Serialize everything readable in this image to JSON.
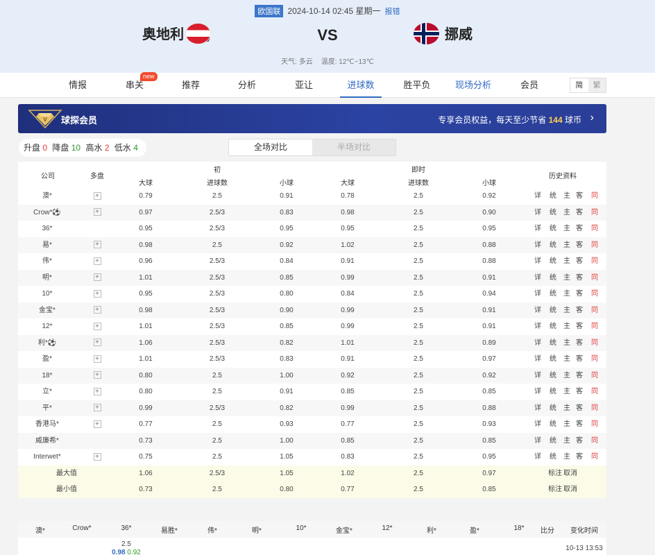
{
  "header": {
    "league": "欧国联",
    "datetime": "2024-10-14 02:45 星期一",
    "report": "报错",
    "home": "奥地利 (主)",
    "away": "挪威",
    "vs": "VS",
    "weather_label": "天气: 多云",
    "temp_label": "温度: 12℃~13℃"
  },
  "nav": {
    "items": [
      "情报",
      "串关",
      "推荐",
      "分析",
      "亚让",
      "进球数",
      "胜平负",
      "现场分析",
      "会员"
    ],
    "active": "进球数",
    "new_badge": "new",
    "lang_simp": "简",
    "lang_trad": "繁"
  },
  "vip": {
    "title": "球探会员",
    "text_prefix": "专享会员权益，每天至少节省",
    "amount": "144",
    "text_suffix": "球币",
    "arrow": "›"
  },
  "summary": {
    "up_label": "升盘",
    "up": "0",
    "down_label": "降盘",
    "down": "10",
    "high_label": "高水",
    "high": "2",
    "low_label": "低水",
    "low": "4"
  },
  "toggle": {
    "full": "全场对比",
    "half": "半场对比"
  },
  "table": {
    "headers": {
      "company": "公司",
      "multi": "多盘",
      "initial": "初",
      "live": "即时",
      "history": "历史资料",
      "over": "大球",
      "goals": "进球数",
      "under": "小球"
    },
    "links": [
      "详",
      "统",
      "主",
      "客",
      "同"
    ],
    "rows": [
      {
        "c": "澳*",
        "m": "+",
        "o1": "0.79",
        "g1": "2.5",
        "u1": "0.91",
        "o2": "0.78",
        "g2": "2.5",
        "u2": "0.92"
      },
      {
        "c": "Crow*⚽",
        "m": "+",
        "o1": "0.97",
        "g1": "2.5/3",
        "u1": "0.83",
        "o2": "0.98",
        "g2": "2.5",
        "u2": "0.90"
      },
      {
        "c": "36*",
        "m": "",
        "o1": "0.95",
        "g1": "2.5/3",
        "u1": "0.95",
        "o2": "0.95",
        "g2": "2.5",
        "u2": "0.95"
      },
      {
        "c": "易*",
        "m": "+",
        "o1": "0.98",
        "g1": "2.5",
        "u1": "0.92",
        "o2": "1.02",
        "g2": "2.5",
        "u2": "0.88"
      },
      {
        "c": "伟*",
        "m": "+",
        "o1": "0.96",
        "g1": "2.5/3",
        "u1": "0.84",
        "o2": "0.91",
        "g2": "2.5",
        "u2": "0.88"
      },
      {
        "c": "明*",
        "m": "+",
        "o1": "1.01",
        "g1": "2.5/3",
        "u1": "0.85",
        "o2": "0.99",
        "g2": "2.5",
        "u2": "0.91"
      },
      {
        "c": "10*",
        "m": "+",
        "o1": "0.95",
        "g1": "2.5/3",
        "u1": "0.80",
        "o2": "0.84",
        "g2": "2.5",
        "u2": "0.94"
      },
      {
        "c": "金宝*",
        "m": "+",
        "o1": "0.98",
        "g1": "2.5/3",
        "u1": "0.90",
        "o2": "0.99",
        "g2": "2.5",
        "u2": "0.91"
      },
      {
        "c": "12*",
        "m": "+",
        "o1": "1.01",
        "g1": "2.5/3",
        "u1": "0.85",
        "o2": "0.99",
        "g2": "2.5",
        "u2": "0.91"
      },
      {
        "c": "利*⚽",
        "m": "+",
        "o1": "1.06",
        "g1": "2.5/3",
        "u1": "0.82",
        "o2": "1.01",
        "g2": "2.5",
        "u2": "0.89"
      },
      {
        "c": "盈*",
        "m": "+",
        "o1": "1.01",
        "g1": "2.5/3",
        "u1": "0.83",
        "o2": "0.91",
        "g2": "2.5",
        "u2": "0.97"
      },
      {
        "c": "18*",
        "m": "+",
        "o1": "0.80",
        "g1": "2.5",
        "u1": "1.00",
        "o2": "0.92",
        "g2": "2.5",
        "u2": "0.92"
      },
      {
        "c": "立*",
        "m": "+",
        "o1": "0.80",
        "g1": "2.5",
        "u1": "0.91",
        "o2": "0.85",
        "g2": "2.5",
        "u2": "0.85"
      },
      {
        "c": "平*",
        "m": "+",
        "o1": "0.99",
        "g1": "2.5/3",
        "u1": "0.82",
        "o2": "0.99",
        "g2": "2.5",
        "u2": "0.88"
      },
      {
        "c": "香港马*",
        "m": "+",
        "o1": "0.77",
        "g1": "2.5",
        "u1": "0.93",
        "o2": "0.77",
        "g2": "2.5",
        "u2": "0.93"
      },
      {
        "c": "威廉希*",
        "m": "",
        "o1": "0.73",
        "g1": "2.5",
        "u1": "1.00",
        "o2": "0.85",
        "g2": "2.5",
        "u2": "0.85"
      },
      {
        "c": "Interwet*",
        "m": "+",
        "o1": "0.75",
        "g1": "2.5",
        "u1": "1.05",
        "o2": "0.83",
        "g2": "2.5",
        "u2": "0.95"
      }
    ],
    "max": {
      "label": "最大值",
      "o1": "1.06",
      "g1": "2.5/3",
      "u1": "1.05",
      "o2": "1.02",
      "g2": "2.5",
      "u2": "0.97",
      "mark": "标注",
      "cancel": "取消"
    },
    "min": {
      "label": "最小值",
      "o1": "0.73",
      "g1": "2.5",
      "u1": "0.80",
      "o2": "0.77",
      "g2": "2.5",
      "u2": "0.85",
      "mark": "标注",
      "cancel": "取消"
    }
  },
  "bottom": {
    "headers": [
      "澳*",
      "Crow*",
      "36*",
      "易胜*",
      "伟*",
      "明*",
      "10*",
      "金宝*",
      "12*",
      "利*",
      "盈*",
      "18*",
      "比分",
      "变化时间"
    ],
    "line": "2.5",
    "v1": "0.98",
    "v2": "0.92",
    "time": "10-13 13:53"
  }
}
